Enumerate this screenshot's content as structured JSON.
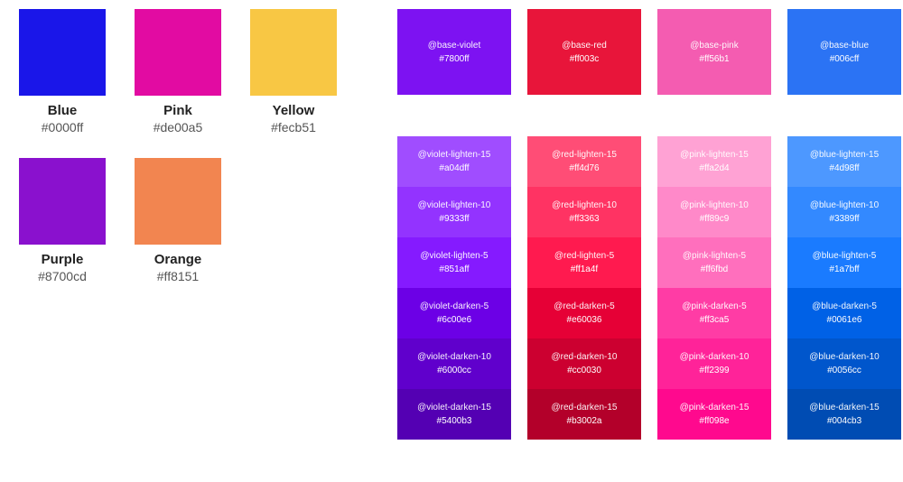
{
  "left_swatches": [
    {
      "name": "Blue",
      "hex": "#0000ff",
      "fill": "#1a16e9"
    },
    {
      "name": "Pink",
      "hex": "#de00a5",
      "fill": "#e20ba2"
    },
    {
      "name": "Yellow",
      "hex": "#fecb51",
      "fill": "#f8c744"
    },
    {
      "name": "Purple",
      "hex": "#8700cd",
      "fill": "#8a11ce"
    },
    {
      "name": "Orange",
      "hex": "#ff8151",
      "fill": "#f28550"
    }
  ],
  "base_tiles": [
    {
      "var": "@base-violet",
      "hex": "#7800ff",
      "fill": "#7d12f2"
    },
    {
      "var": "@base-red",
      "hex": "#ff003c",
      "fill": "#e8153a"
    },
    {
      "var": "@base-pink",
      "hex": "#ff56b1",
      "fill": "#f45cb1"
    },
    {
      "var": "@base-blue",
      "hex": "#006cff",
      "fill": "#2b73f4"
    }
  ],
  "palette_columns": [
    {
      "key": "violet",
      "steps": [
        {
          "var": "@violet-lighten-15",
          "hex": "#a04dff",
          "fill": "#a04dff"
        },
        {
          "var": "@violet-lighten-10",
          "hex": "#9333ff",
          "fill": "#9333ff"
        },
        {
          "var": "@violet-lighten-5",
          "hex": "#851aff",
          "fill": "#851aff"
        },
        {
          "var": "@violet-darken-5",
          "hex": "#6c00e6",
          "fill": "#6c00e6"
        },
        {
          "var": "@violet-darken-10",
          "hex": "#6000cc",
          "fill": "#6000cc"
        },
        {
          "var": "@violet-darken-15",
          "hex": "#5400b3",
          "fill": "#5400b3"
        }
      ]
    },
    {
      "key": "red",
      "steps": [
        {
          "var": "@red-lighten-15",
          "hex": "#ff4d76",
          "fill": "#ff4d76"
        },
        {
          "var": "@red-lighten-10",
          "hex": "#ff3363",
          "fill": "#ff3363"
        },
        {
          "var": "@red-lighten-5",
          "hex": "#ff1a4f",
          "fill": "#ff1a4f"
        },
        {
          "var": "@red-darken-5",
          "hex": "#e60036",
          "fill": "#e60036"
        },
        {
          "var": "@red-darken-10",
          "hex": "#cc0030",
          "fill": "#cc0030"
        },
        {
          "var": "@red-darken-15",
          "hex": "#b3002a",
          "fill": "#b3002a"
        }
      ]
    },
    {
      "key": "pink",
      "steps": [
        {
          "var": "@pink-lighten-15",
          "hex": "#ffa2d4",
          "fill": "#ffa2d4"
        },
        {
          "var": "@pink-lighten-10",
          "hex": "#ff89c9",
          "fill": "#ff89c9"
        },
        {
          "var": "@pink-lighten-5",
          "hex": "#ff6fbd",
          "fill": "#ff6fbd"
        },
        {
          "var": "@pink-darken-5",
          "hex": "#ff3ca5",
          "fill": "#ff3ca5"
        },
        {
          "var": "@pink-darken-10",
          "hex": "#ff2399",
          "fill": "#ff2399"
        },
        {
          "var": "@pink-darken-15",
          "hex": "#ff098e",
          "fill": "#ff098e"
        }
      ]
    },
    {
      "key": "blue",
      "steps": [
        {
          "var": "@blue-lighten-15",
          "hex": "#4d98ff",
          "fill": "#4d98ff"
        },
        {
          "var": "@blue-lighten-10",
          "hex": "#3389ff",
          "fill": "#3389ff"
        },
        {
          "var": "@blue-lighten-5",
          "hex": "#1a7bff",
          "fill": "#1a7bff"
        },
        {
          "var": "@blue-darken-5",
          "hex": "#0061e6",
          "fill": "#0061e6"
        },
        {
          "var": "@blue-darken-10",
          "hex": "#0056cc",
          "fill": "#0056cc"
        },
        {
          "var": "@blue-darken-15",
          "hex": "#004cb3",
          "fill": "#004cb3"
        }
      ]
    }
  ]
}
